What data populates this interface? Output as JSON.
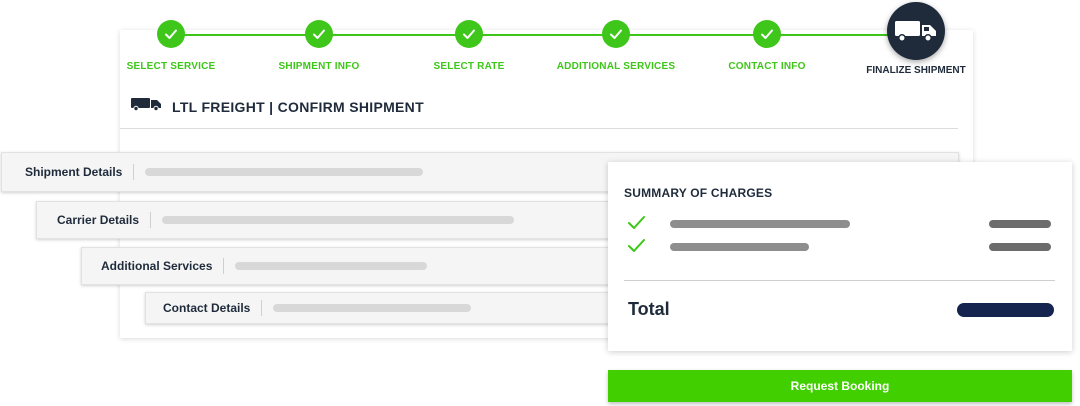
{
  "progress": {
    "steps": [
      {
        "label": "SELECT SERVICE",
        "status": "complete"
      },
      {
        "label": "SHIPMENT INFO",
        "status": "complete"
      },
      {
        "label": "SELECT RATE",
        "status": "complete"
      },
      {
        "label": "ADDITIONAL SERVICES",
        "status": "complete"
      },
      {
        "label": "CONTACT INFO",
        "status": "complete"
      },
      {
        "label": "FINALIZE SHIPMENT",
        "status": "current"
      }
    ],
    "complete_color": "#3ec61a",
    "current_color": "#1f2b3b",
    "complete_icon": "check-icon",
    "current_icon": "truck-icon"
  },
  "header": {
    "icon": "truck-icon",
    "title": "LTL FREIGHT | CONFIRM SHIPMENT"
  },
  "sections": [
    {
      "label": "Shipment Details"
    },
    {
      "label": "Carrier Details"
    },
    {
      "label": "Additional Services"
    },
    {
      "label": "Contact Details"
    }
  ],
  "summary": {
    "title": "SUMMARY OF CHARGES",
    "line_item_icon": "check-icon",
    "total_label": "Total"
  },
  "actions": {
    "request_booking": "Request Booking",
    "button_color": "#41cf00"
  }
}
